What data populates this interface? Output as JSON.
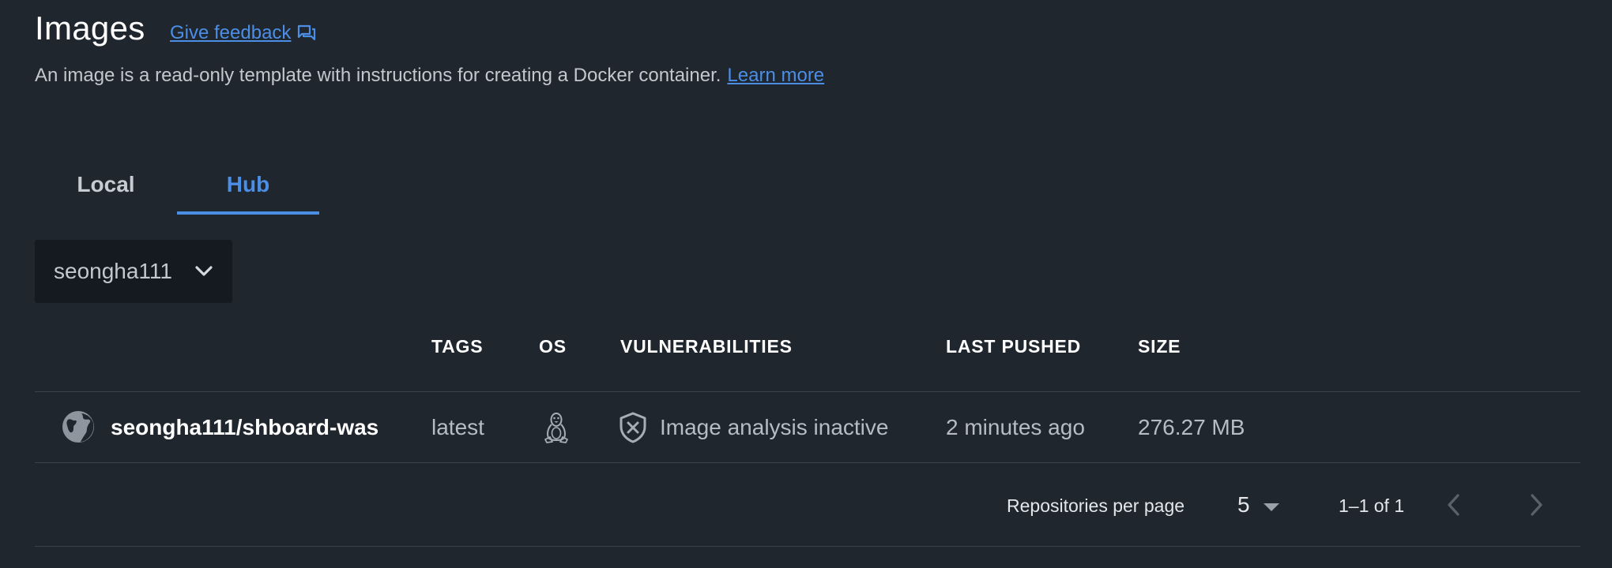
{
  "header": {
    "title": "Images",
    "feedback_label": "Give feedback",
    "feedback_icon": "feedback-icon",
    "description": "An image is a read-only template with instructions for creating a Docker container.",
    "learn_more_label": "Learn more"
  },
  "tabs": [
    {
      "label": "Local",
      "active": false
    },
    {
      "label": "Hub",
      "active": true
    }
  ],
  "org_selector": {
    "value": "seongha111",
    "icon": "chevron-down-icon"
  },
  "table": {
    "columns": [
      "TAGS",
      "OS",
      "VULNERABILITIES",
      "LAST PUSHED",
      "SIZE"
    ],
    "rows": [
      {
        "visibility_icon": "globe-icon",
        "name": "seongha111/shboard-was",
        "tag": "latest",
        "os_icon": "linux-tux-icon",
        "vulnerabilities_icon": "shield-x-icon",
        "vulnerabilities": "Image analysis inactive",
        "last_pushed": "2 minutes ago",
        "size": "276.27 MB"
      }
    ]
  },
  "pagination": {
    "per_page_label": "Repositories per page",
    "per_page_value": "5",
    "range": "1–1 of 1",
    "prev_icon": "chevron-left-icon",
    "next_icon": "chevron-right-icon"
  },
  "colors": {
    "background": "#20262e",
    "accent": "#4b8ee6",
    "select_background": "#151a20",
    "divider": "#3b434d"
  }
}
